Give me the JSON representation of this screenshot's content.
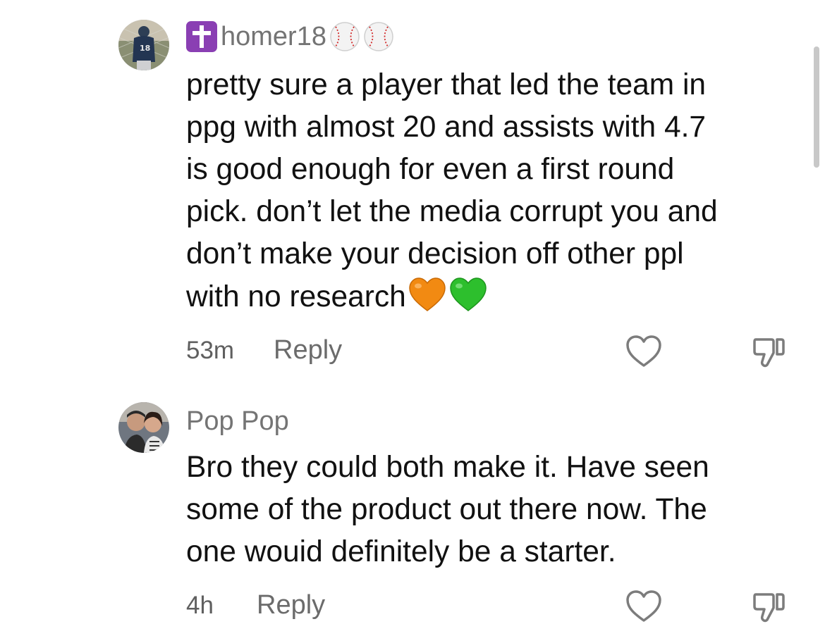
{
  "comments": [
    {
      "username": "homer18",
      "text_lines": [
        "pretty sure a player that led the team in",
        "ppg with almost 20 and assists with 4.7",
        "is good enough for even a first round",
        "pick. don’t let the media corrupt you and",
        "don’t make your decision off other ppl",
        "with no research"
      ],
      "time": "53m",
      "reply_label": "Reply",
      "badge_icon": "latin-cross-icon",
      "trailing_emojis": [
        "orange-heart-icon",
        "green-heart-icon"
      ]
    },
    {
      "username": "Pop Pop",
      "text_lines": [
        "Bro they could both make it. Have seen",
        "some of the product out there now. The",
        "one wouid definitely be a starter."
      ],
      "time": "4h",
      "reply_label": "Reply"
    }
  ],
  "colors": {
    "username": "#747474",
    "text": "#111111",
    "meta": "#5f5f5f",
    "badge": "#8a3fb3",
    "orange_heart": "#f28a12",
    "green_heart": "#2dbf2d"
  }
}
